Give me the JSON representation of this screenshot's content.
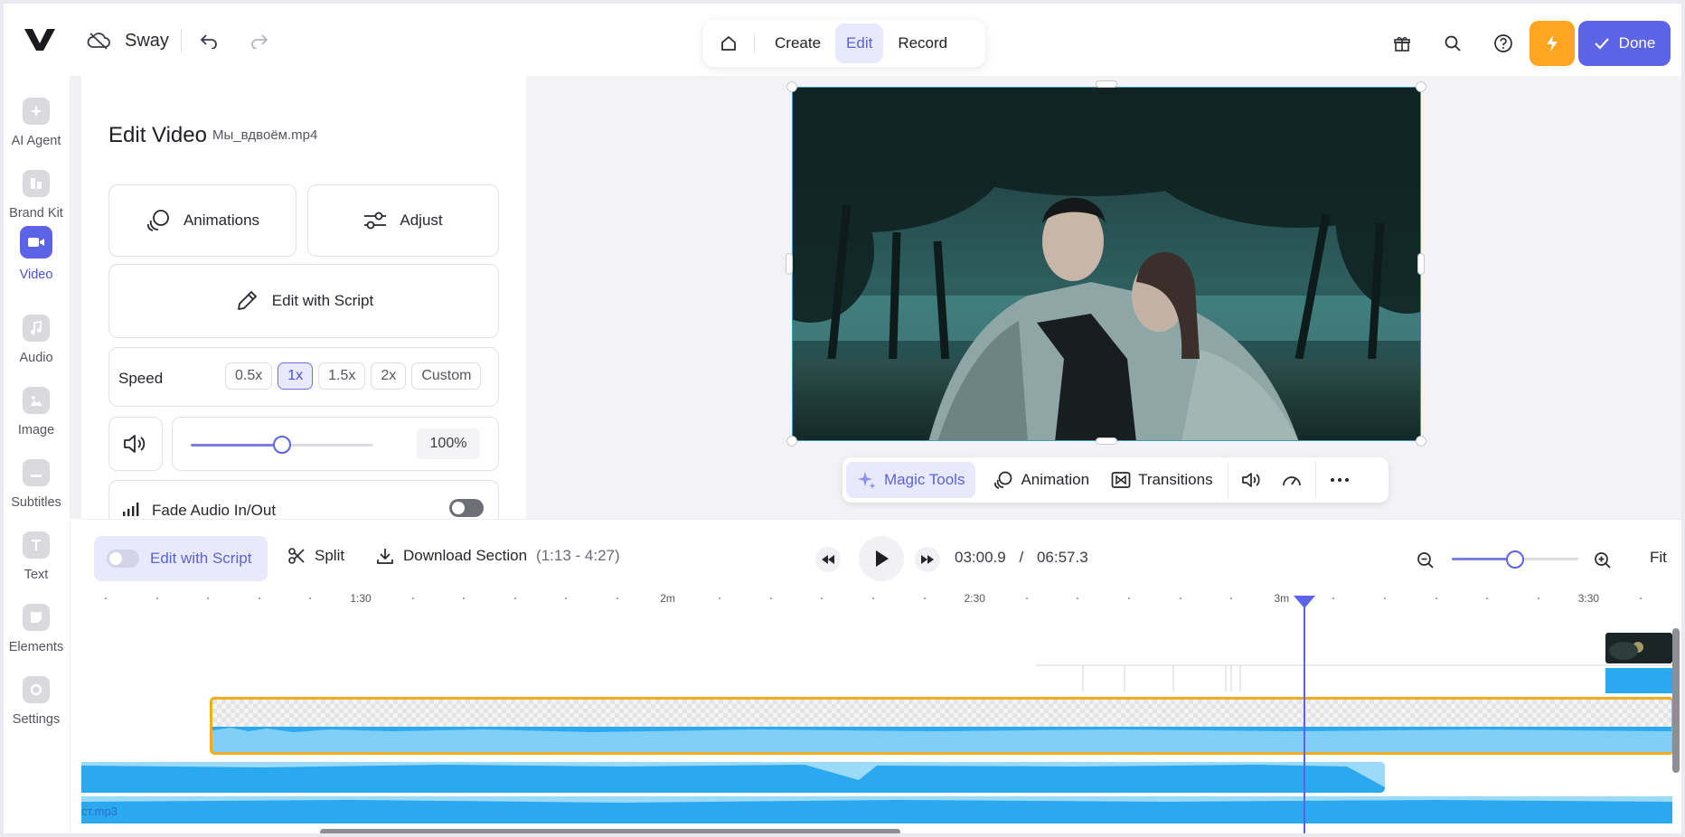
{
  "app": {
    "logo": "V",
    "project_name": "Sway"
  },
  "modes": {
    "items": [
      {
        "label": "Create",
        "active": false
      },
      {
        "label": "Edit",
        "active": true
      },
      {
        "label": "Record",
        "active": false
      }
    ]
  },
  "header_actions": {
    "done_label": "Done",
    "accent_color": "#5d63e6",
    "bolt_color": "#ffa51f"
  },
  "rail": {
    "items": [
      {
        "label": "AI Agent",
        "icon": "sparkle-icon",
        "active": false
      },
      {
        "label": "Brand Kit",
        "icon": "brand-kit-icon",
        "active": false
      },
      {
        "label": "Video",
        "icon": "video-camera-icon",
        "active": true
      },
      {
        "label": "Audio",
        "icon": "music-note-icon",
        "active": false
      },
      {
        "label": "Image",
        "icon": "image-icon",
        "active": false
      },
      {
        "label": "Subtitles",
        "icon": "subtitles-icon",
        "active": false
      },
      {
        "label": "Text",
        "icon": "text-icon",
        "active": false
      },
      {
        "label": "Elements",
        "icon": "elements-icon",
        "active": false
      },
      {
        "label": "Settings",
        "icon": "gear-icon",
        "active": false
      }
    ]
  },
  "panel": {
    "title": "Edit Video",
    "file_name": "Мы_вдвоём.mp4",
    "animations_label": "Animations",
    "adjust_label": "Adjust",
    "edit_script_label": "Edit with Script",
    "speed": {
      "label": "Speed",
      "options": [
        "0.5x",
        "1x",
        "1.5x",
        "2x",
        "Custom"
      ],
      "selected": "1x"
    },
    "volume": {
      "value": "100%",
      "level": 0.5
    },
    "fade_label": "Fade Audio In/Out"
  },
  "magic_toolbar": {
    "magic_tools": "Magic Tools",
    "animation": "Animation",
    "transitions": "Transitions"
  },
  "timeline": {
    "edit_script_label": "Edit with Script",
    "split_label": "Split",
    "download_label": "Download Section",
    "download_range": "(1:13 - 4:27)",
    "current_time": "03:00.9",
    "separator": "/",
    "total_time": "06:57.3",
    "zoom_level": 0.5,
    "fit_label": "Fit",
    "ruler_labels": [
      "1:30",
      "2m",
      "2:30",
      "3m",
      "3:30"
    ],
    "audio_file": "ст.mp3",
    "selection_color": "#f0ad1e",
    "waveform_color": "#2aa8f0"
  }
}
